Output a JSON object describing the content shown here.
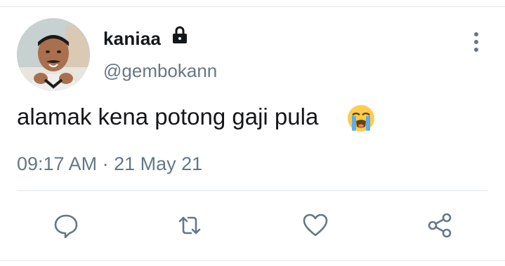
{
  "tweet": {
    "display_name": "kaniaa",
    "username": "@gembokann",
    "text": "alamak kena potong gaji pula",
    "emoji": "loudly-crying-face",
    "time": "09:17 AM",
    "separator": "·",
    "date": "21 May 21",
    "protected_account_icon": "lock-icon",
    "more_menu_icon": "vertical-dots-icon"
  },
  "actions": [
    {
      "name": "reply",
      "icon": "speech-bubble-icon"
    },
    {
      "name": "retweet",
      "icon": "retweet-icon"
    },
    {
      "name": "like",
      "icon": "heart-icon"
    },
    {
      "name": "share",
      "icon": "share-icon"
    }
  ],
  "colors": {
    "primary_text": "#14171a",
    "secondary_text": "#657786",
    "icon": "#657786",
    "divider": "#e1e8ed"
  }
}
